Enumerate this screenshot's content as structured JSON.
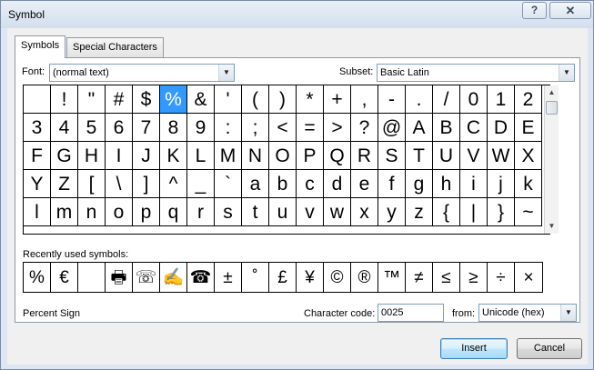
{
  "window": {
    "title": "Symbol"
  },
  "titlebar": {
    "help_glyph": "?",
    "close_glyph": "✕"
  },
  "tabs": [
    {
      "label": "Symbols",
      "active": true
    },
    {
      "label": "Special Characters",
      "active": false
    }
  ],
  "font": {
    "label": "Font:",
    "value": "(normal text)"
  },
  "subset": {
    "label": "Subset:",
    "value": "Basic Latin"
  },
  "symbols": [
    [
      "",
      "!",
      "\"",
      "#",
      "$",
      "%",
      "&",
      "'",
      "(",
      ")",
      "*",
      "+",
      ",",
      "-",
      ".",
      "/",
      "0",
      "1",
      "2"
    ],
    [
      "3",
      "4",
      "5",
      "6",
      "7",
      "8",
      "9",
      ":",
      ";",
      "<",
      "=",
      ">",
      "?",
      "@",
      "A",
      "B",
      "C",
      "D",
      "E"
    ],
    [
      "F",
      "G",
      "H",
      "I",
      "J",
      "K",
      "L",
      "M",
      "N",
      "O",
      "P",
      "Q",
      "R",
      "S",
      "T",
      "U",
      "V",
      "W",
      "X"
    ],
    [
      "Y",
      "Z",
      "[",
      "\\",
      "]",
      "^",
      "_",
      "`",
      "a",
      "b",
      "c",
      "d",
      "e",
      "f",
      "g",
      "h",
      "i",
      "j",
      "k"
    ],
    [
      "l",
      "m",
      "n",
      "o",
      "p",
      "q",
      "r",
      "s",
      "t",
      "u",
      "v",
      "w",
      "x",
      "y",
      "z",
      "{",
      "|",
      "}",
      "~"
    ]
  ],
  "selected_symbol": "%",
  "recent": {
    "label": "Recently used symbols:",
    "items": [
      "%",
      "€",
      "",
      "🖶",
      "☏",
      "✍",
      "☎",
      "±",
      "˚",
      "£",
      "¥",
      "©",
      "®",
      "™",
      "≠",
      "≤",
      "≥",
      "÷",
      "×"
    ]
  },
  "symbol_name": "Percent Sign",
  "character_code": {
    "label": "Character code:",
    "value": "0025"
  },
  "from": {
    "label": "from:",
    "value": "Unicode (hex)"
  },
  "buttons": {
    "insert": "Insert",
    "cancel": "Cancel"
  },
  "icons": {
    "dropdown": "chevron-down-icon",
    "scroll_up": "scroll-up-icon",
    "scroll_down": "scroll-down-icon"
  }
}
